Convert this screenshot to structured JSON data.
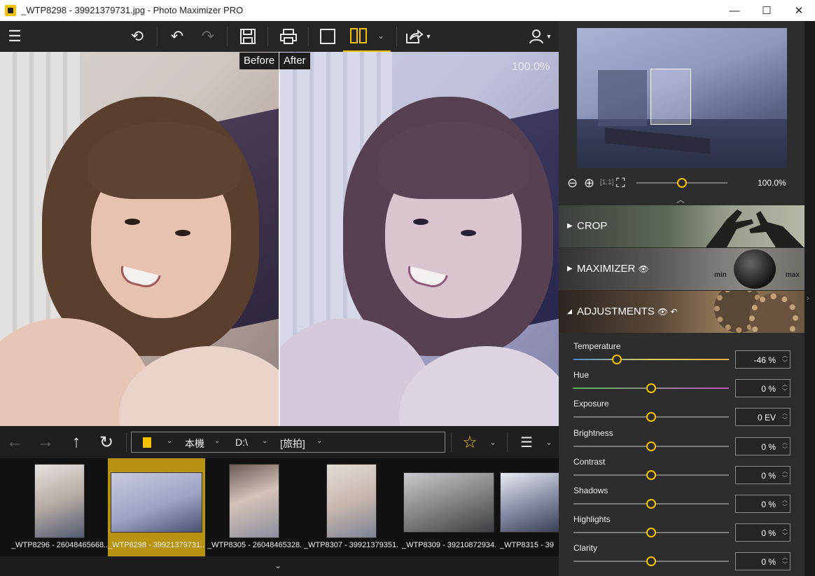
{
  "window": {
    "title": "_WTP8298 - 39921379731.jpg - Photo Maximizer PRO",
    "min_glyph": "—",
    "max_glyph": "☐",
    "close_glyph": "✕"
  },
  "toolbar": {
    "menu_icon": "☰",
    "undo_all_icon": "⟲",
    "undo_icon": "↶",
    "redo_icon": "↷",
    "save_icon": "💾",
    "print_icon": "⎙",
    "single_view_icon": "▢",
    "split_view_icon": "▯▯",
    "view_dropdown": "⌄",
    "share_icon": "⇪",
    "user_icon": "👤"
  },
  "viewer": {
    "before_label": "Before",
    "after_label": "After",
    "zoom": "100.0%"
  },
  "navbar": {
    "back_icon": "←",
    "forward_icon": "→",
    "up_icon": "↑",
    "refresh_icon": "↻",
    "path": [
      "本機",
      "D:\\",
      "[旅拍]"
    ],
    "star_icon": "☆",
    "sort_icon": "☰"
  },
  "thumbnails": [
    {
      "name": "_WTP8296 - 26048465668...",
      "selected": false
    },
    {
      "name": "_WTP8298 - 39921379731...",
      "selected": true
    },
    {
      "name": "_WTP8305 - 26048465328...",
      "selected": false
    },
    {
      "name": "_WTP8307 - 39921379351...",
      "selected": false
    },
    {
      "name": "_WTP8309 - 39210872934...",
      "selected": false
    },
    {
      "name": "_WTP8315 - 39",
      "selected": false
    }
  ],
  "navigator": {
    "zoom_out_icon": "⊖",
    "zoom_in_icon": "⊕",
    "fit_icon": "[1:1]",
    "zoom_fit_icon": "⛶",
    "zoom_value": "100.0%",
    "zoom_fraction": 0.5
  },
  "sections": [
    {
      "title": "CROP",
      "expanded": false,
      "icons": ""
    },
    {
      "title": "MAXIMIZER",
      "expanded": false,
      "icons": "👁",
      "dial_min": "min",
      "dial_max": "max"
    },
    {
      "title": "ADJUSTMENTS",
      "expanded": true,
      "icons": "👁 ↶"
    }
  ],
  "adjustments": [
    {
      "label": "Temperature",
      "value": "-46 %",
      "fraction": 0.28
    },
    {
      "label": "Hue",
      "value": "0 %",
      "fraction": 0.5
    },
    {
      "label": "Exposure",
      "value": "0 EV",
      "fraction": 0.5
    },
    {
      "label": "Brightness",
      "value": "0 %",
      "fraction": 0.5
    },
    {
      "label": "Contrast",
      "value": "0 %",
      "fraction": 0.5
    },
    {
      "label": "Shadows",
      "value": "0 %",
      "fraction": 0.5
    },
    {
      "label": "Highlights",
      "value": "0 %",
      "fraction": 0.5
    },
    {
      "label": "Clarity",
      "value": "0 %",
      "fraction": 0.5
    }
  ],
  "colors": {
    "accent": "#f5c200",
    "panel_bg": "#2d2d2d",
    "selected_thumb": "#b8930f"
  }
}
